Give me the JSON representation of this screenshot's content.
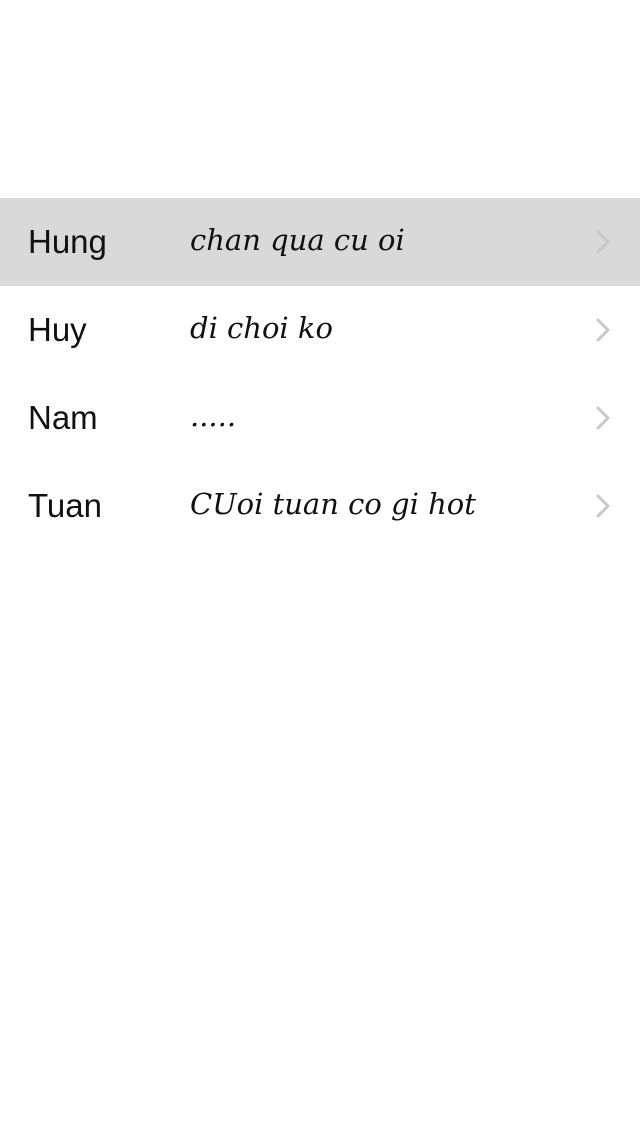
{
  "contacts": [
    {
      "name": "Hung",
      "message": "chan qua cu oi",
      "selected": true,
      "chevron_icon": "chevron-right-icon"
    },
    {
      "name": "Huy",
      "message": "di choi ko",
      "selected": false,
      "chevron_icon": "chevron-right-icon"
    },
    {
      "name": "Nam",
      "message": ".....",
      "selected": false,
      "chevron_icon": "chevron-right-icon"
    },
    {
      "name": "Tuan",
      "message": "CUoi tuan co gi hot",
      "selected": false,
      "chevron_icon": "chevron-right-icon"
    }
  ],
  "colors": {
    "selected_row": "#d9d9d9",
    "chevron": "#c7c7cc",
    "text": "#111111",
    "background": "#ffffff"
  }
}
